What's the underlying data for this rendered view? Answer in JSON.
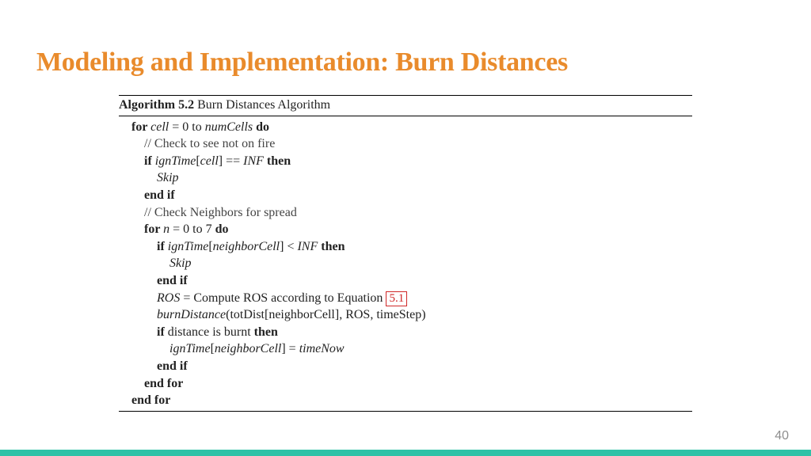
{
  "title": "Modeling and Implementation: Burn Distances",
  "page_number": "40",
  "algorithm": {
    "label_bold": "Algorithm 5.2",
    "label_rest": " Burn Distances Algorithm",
    "lines": {
      "l1_for": "for ",
      "l1_cell": "cell",
      "l1_eq0to": " = 0 to ",
      "l1_numcells": "numCells",
      "l1_do": " do",
      "l2_comment": "// Check to see not on fire",
      "l3_if": "if ",
      "l3_ign": "ignTime",
      "l3_lb": "[",
      "l3_cell": "cell",
      "l3_rb": "] == ",
      "l3_inf": "INF",
      "l3_then": " then",
      "l4_skip": "Skip",
      "l5_endif": "end if",
      "l6_comment": "// Check Neighbors for spread",
      "l7_for": "for ",
      "l7_n": "n",
      "l7_eq": " = 0 to 7 ",
      "l7_do": "do",
      "l8_if": "if ",
      "l8_ign": "ignTime",
      "l8_lb": "[",
      "l8_nc": "neighborCell",
      "l8_rb": "] < ",
      "l8_inf": "INF",
      "l8_then": " then",
      "l9_skip": "Skip",
      "l10_endif": "end if",
      "l11_ros": "ROS",
      "l11_eq": " = Compute ROS according to Equation ",
      "l11_eqref": "5.1",
      "l12_bd": "burnDistance",
      "l12_args": "(totDist[neighborCell], ROS, timeStep)",
      "l13_if": "if ",
      "l13_cond": "distance is burnt ",
      "l13_then": "then",
      "l14_ign": "ignTime",
      "l14_lb": "[",
      "l14_nc": "neighborCell",
      "l14_rb": "] = ",
      "l14_tn": "timeNow",
      "l15_endif": "end if",
      "l16_endfor": "end for",
      "l17_endfor": "end for"
    }
  }
}
